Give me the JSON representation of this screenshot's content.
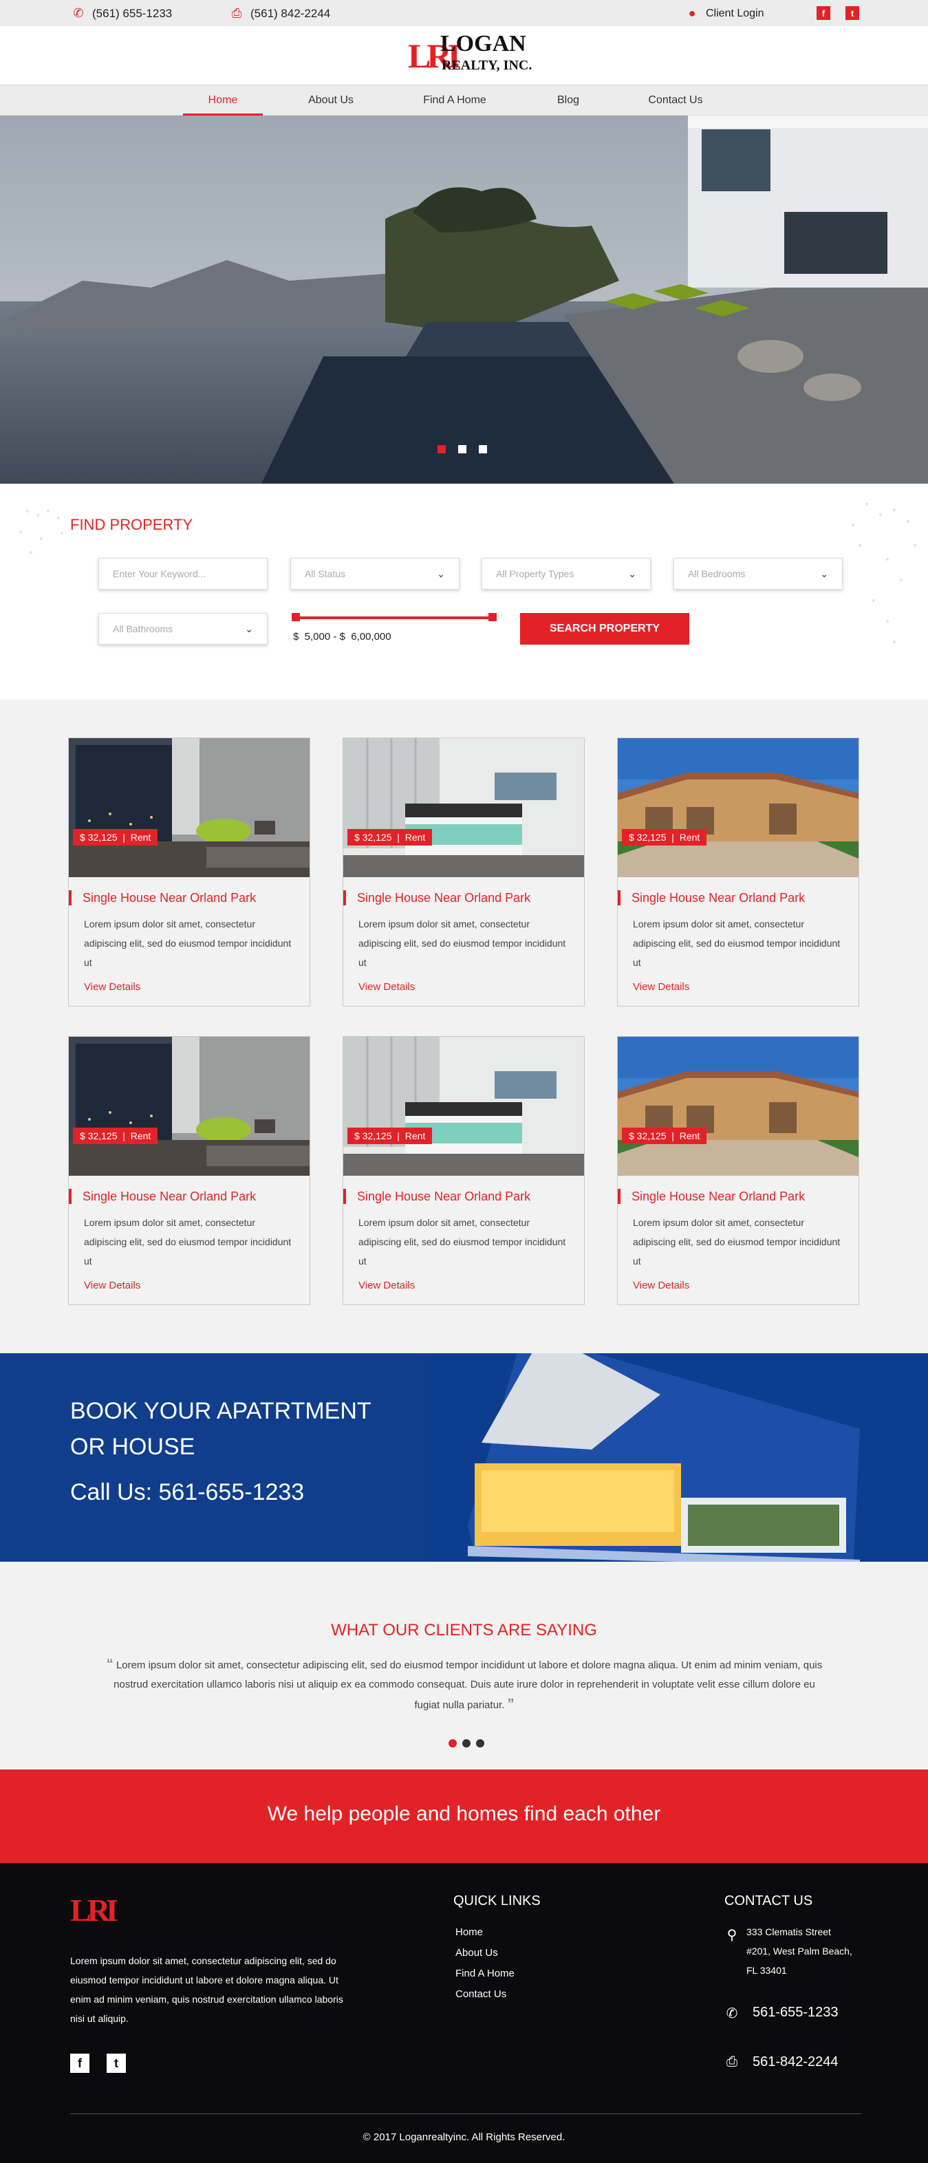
{
  "topbar": {
    "phone": "(561) 655-1233",
    "fax": "(561) 842-2244",
    "client_login": "Client Login",
    "social": [
      "f",
      "t"
    ]
  },
  "brand": {
    "mark": "LRI",
    "name": "LOGAN",
    "sub": "REALTY, INC."
  },
  "nav": {
    "items": [
      {
        "label": "Home",
        "active": true
      },
      {
        "label": "About Us"
      },
      {
        "label": "Find A Home"
      },
      {
        "label": "Blog"
      },
      {
        "label": "Contact Us"
      }
    ]
  },
  "find": {
    "title": "FIND PROPERTY",
    "keyword_placeholder": "Enter Your Keyword...",
    "status": "All Status",
    "types": "All Property Types",
    "bedrooms": "All Bedrooms",
    "bathrooms": "All Bathrooms",
    "price_range": "$  5,000 - $  6,00,000",
    "search_button": "SEARCH PROPERTY"
  },
  "listings": [
    {
      "price": "$ 32,125",
      "type": "Rent",
      "title": "Single House Near Orland Park",
      "desc": "Lorem ipsum dolor sit amet, consectetur adipiscing elit, sed do eiusmod tempor incididunt ut",
      "link": "View Details",
      "img": "bedroom-dark"
    },
    {
      "price": "$ 32,125",
      "type": "Rent",
      "title": "Single House Near Orland Park",
      "desc": "Lorem ipsum dolor sit amet, consectetur adipiscing elit, sed do eiusmod tempor incididunt ut",
      "link": "View Details",
      "img": "bedroom-light"
    },
    {
      "price": "$ 32,125",
      "type": "Rent",
      "title": "Single House Near Orland Park",
      "desc": "Lorem ipsum dolor sit amet, consectetur adipiscing elit, sed do eiusmod tempor incididunt ut",
      "link": "View Details",
      "img": "house-exterior"
    },
    {
      "price": "$ 32,125",
      "type": "Rent",
      "title": "Single House Near Orland Park",
      "desc": "Lorem ipsum dolor sit amet, consectetur adipiscing elit, sed do eiusmod tempor incididunt ut",
      "link": "View Details",
      "img": "bedroom-dark"
    },
    {
      "price": "$ 32,125",
      "type": "Rent",
      "title": "Single House Near Orland Park",
      "desc": "Lorem ipsum dolor sit amet, consectetur adipiscing elit, sed do eiusmod tempor incididunt ut",
      "link": "View Details",
      "img": "bedroom-light"
    },
    {
      "price": "$ 32,125",
      "type": "Rent",
      "title": "Single House Near Orland Park",
      "desc": "Lorem ipsum dolor sit amet, consectetur adipiscing elit, sed do eiusmod tempor incididunt ut",
      "link": "View Details",
      "img": "house-exterior"
    }
  ],
  "book": {
    "line1": "BOOK YOUR APATRTMENT",
    "line2": "OR HOUSE",
    "call": "Call Us: 561-655-1233"
  },
  "testimonials": {
    "title": "WHAT OUR CLIENTS ARE SAYING",
    "quote": "Lorem ipsum dolor sit amet, consectetur adipiscing elit, sed do eiusmod tempor incididunt ut labore et dolore magna aliqua. Ut enim ad minim veniam, quis nostrud exercitation ullamco laboris nisi ut aliquip ex ea commodo consequat. Duis aute irure dolor in reprehenderit in voluptate velit esse cillum dolore eu fugiat nulla pariatur."
  },
  "tagline": "We help people and homes find each other",
  "footer": {
    "logo": "LRI",
    "about": "Lorem ipsum dolor sit amet, consectetur adipiscing elit, sed do eiusmod tempor incididunt ut labore et dolore magna aliqua. Ut enim ad minim veniam, quis nostrud exercitation ullamco laboris nisi ut aliquip.",
    "quick_links_title": "QUICK LINKS",
    "quick_links": [
      "Home",
      "About Us",
      "Find A Home",
      "Contact Us"
    ],
    "contact_title": "CONTACT US",
    "address": [
      "333 Clematis Street",
      "#201, West Palm Beach,",
      "FL 33401"
    ],
    "phone": "561-655-1233",
    "fax": "561-842-2244",
    "copyright": "© 2017 Loganrealtyinc. All Rights Reserved.",
    "social": [
      "f",
      "t"
    ]
  },
  "colors": {
    "accent": "#e32227",
    "band_blue": "#0d3d8f",
    "footer_bg": "#0b0b0d"
  }
}
